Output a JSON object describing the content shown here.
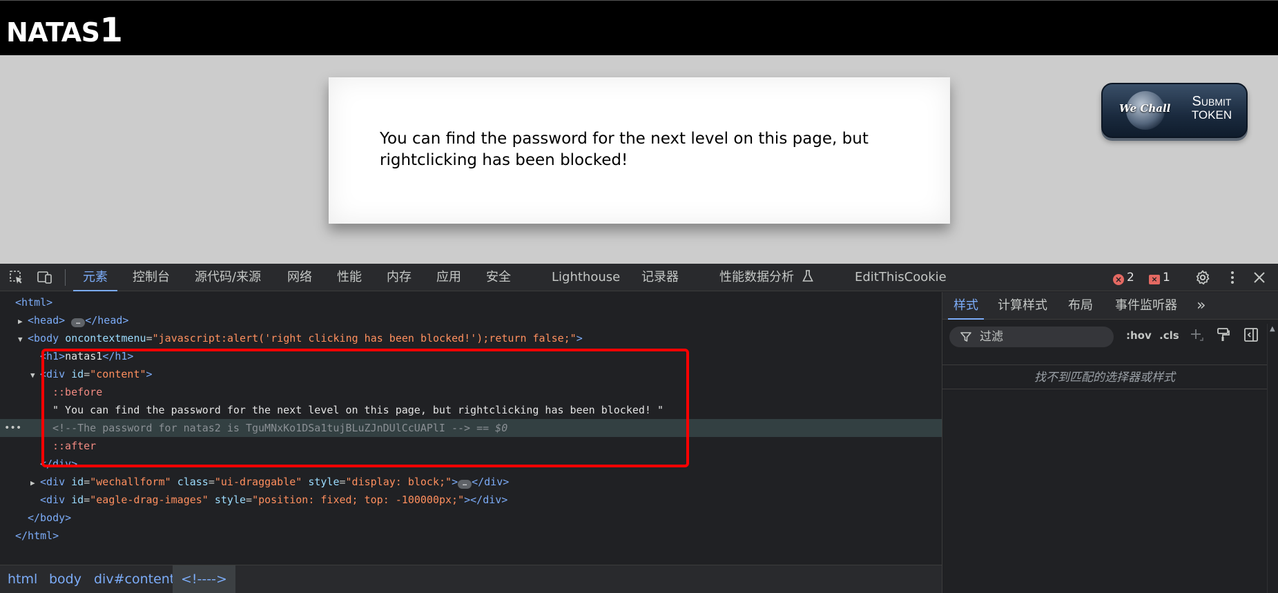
{
  "page": {
    "title_prefix": "NATAS",
    "title_level": "1",
    "content_text": "You can find the password for the next level on this page, but rightclicking has been blocked!",
    "wechall": {
      "logo": "We Chall",
      "submit_line1": "Submit",
      "submit_line2": "TOKEN"
    }
  },
  "devtools": {
    "tabs": [
      "元素",
      "控制台",
      "源代码/来源",
      "网络",
      "性能",
      "内存",
      "应用",
      "安全",
      "Lighthouse",
      "记录器",
      "性能数据分析",
      "EditThisCookie"
    ],
    "active_tab": "元素",
    "error_count": "2",
    "issue_count": "1",
    "elements": {
      "lines": [
        {
          "indent": 0,
          "html_open": "<html>"
        },
        {
          "indent": 1,
          "head_open": "<head>",
          "head_close": "</head>",
          "ellipsis": "…"
        },
        {
          "body_open": "<body",
          "attr_name": "oncontextmenu",
          "attr_val": "\"javascript:alert('right clicking has been blocked!');return false;\"",
          "close": ">"
        },
        {
          "h1_open": "<h1>",
          "h1_text": "natas1",
          "h1_close": "</h1>"
        },
        {
          "div_open": "<div",
          "attr_name": "id",
          "attr_val": "\"content\"",
          "close": ">"
        },
        {
          "pseudo": "::before"
        },
        {
          "text": "\" You can find the password for the next level on this page, but rightclicking has been blocked! \""
        },
        {
          "comment": "<!--The password for natas2 is TguMNxKo1DSa1tujBLuZJnDUlCcUAPlI -->",
          "dollar": "== $0"
        },
        {
          "pseudo": "::after"
        },
        {
          "div_close": "</div>"
        },
        {
          "open": "<div",
          "a1": "id",
          "v1": "\"wechallform\"",
          "a2": "class",
          "v2": "\"ui-draggable\"",
          "a3": "style",
          "v3": "\"display: block;\"",
          "close": ">",
          "ellipsis": "…",
          "end": "</div>"
        },
        {
          "open": "<div",
          "a1": "id",
          "v1": "\"eagle-drag-images\"",
          "a2": "style",
          "v2": "\"position: fixed; top: -100000px;\"",
          "close": ">",
          "end": "</div>"
        },
        {
          "body_close": "</body>"
        },
        {
          "html_close": "</html>"
        }
      ]
    },
    "breadcrumb": [
      "html",
      "body",
      "div#content",
      "<!---->"
    ],
    "styles": {
      "tabs": [
        "样式",
        "计算样式",
        "布局",
        "事件监听器",
        "»"
      ],
      "active_tab": "样式",
      "filter_placeholder": "过滤",
      "hov": ":hov",
      "cls": ".cls",
      "no_match": "找不到匹配的选择器或样式"
    }
  }
}
